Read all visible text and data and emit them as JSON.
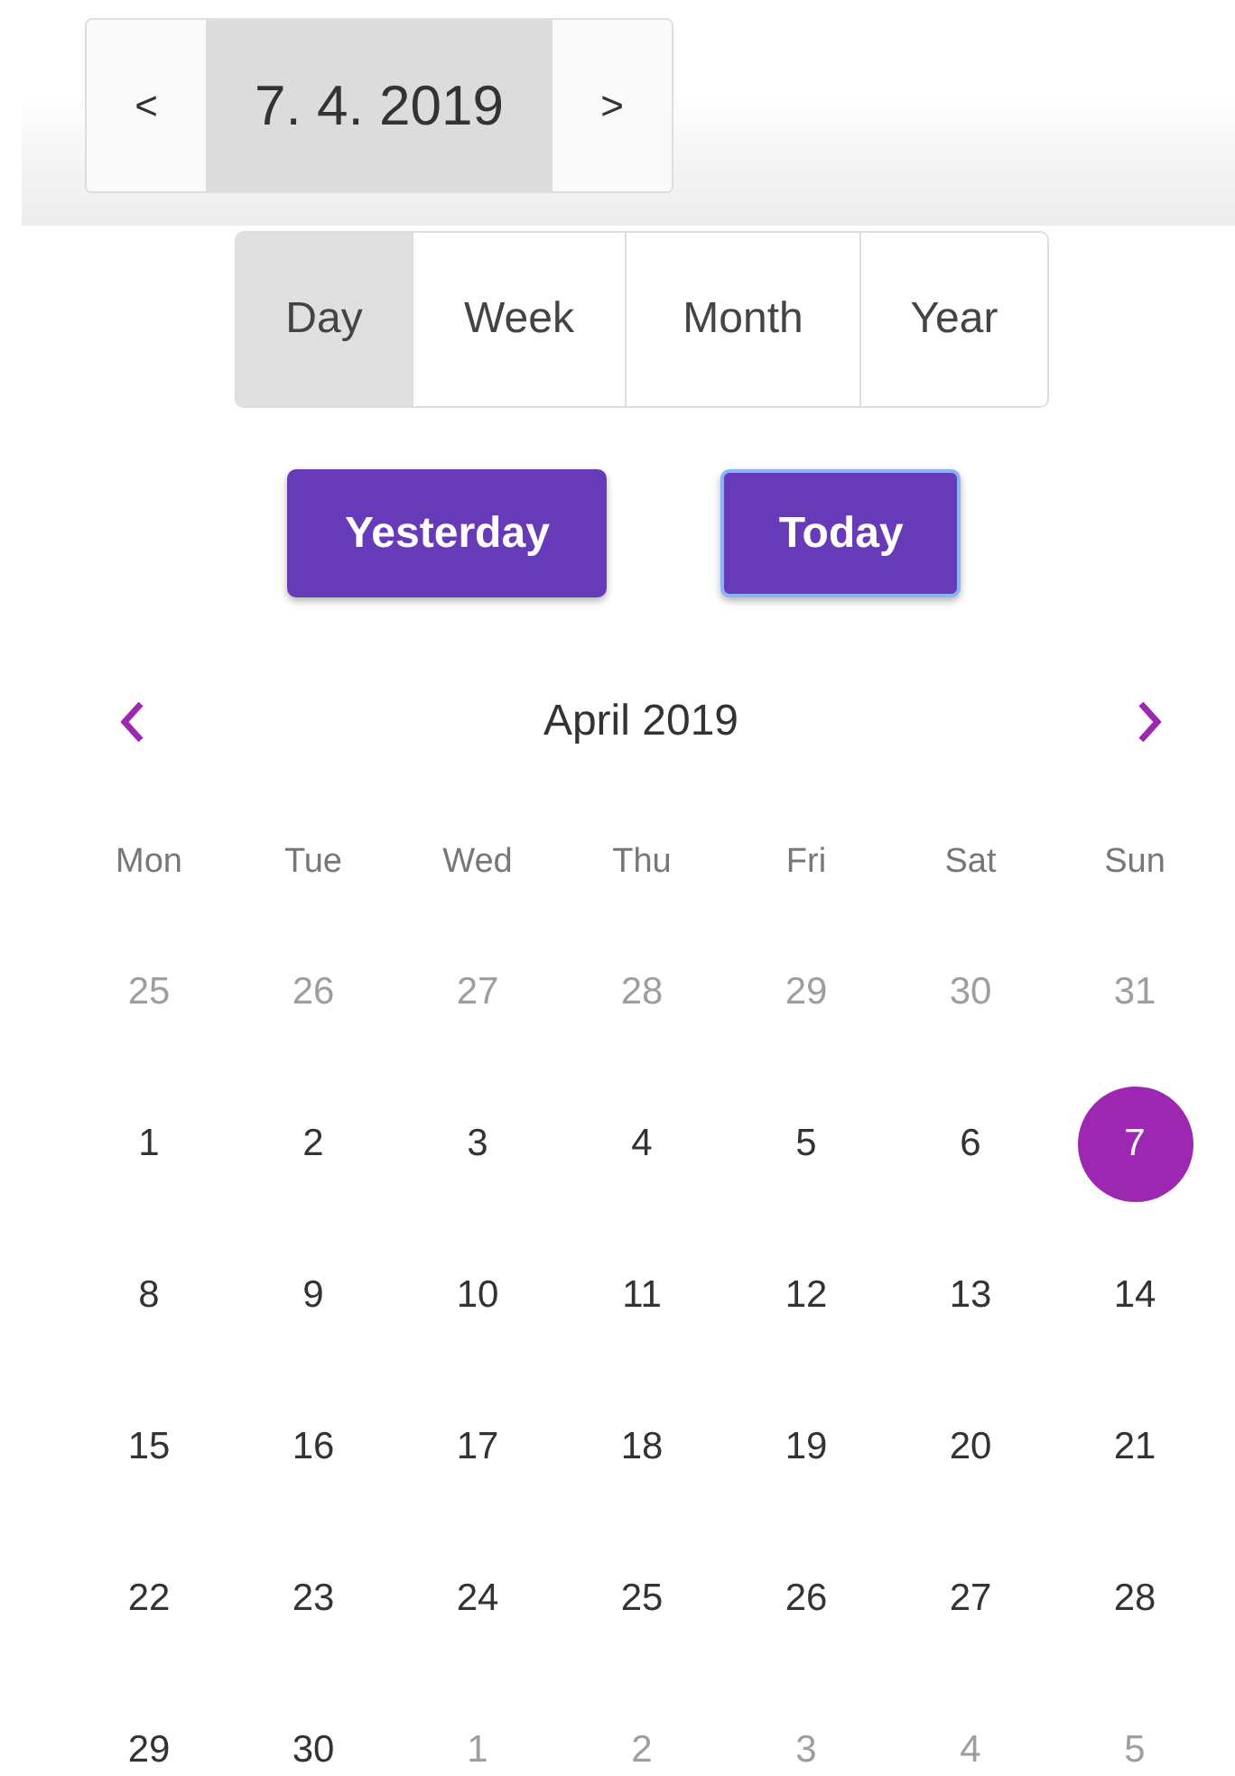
{
  "date_nav": {
    "prev": "<",
    "date": "7. 4. 2019",
    "next": ">"
  },
  "view_tabs": [
    {
      "label": "Day",
      "selected": true
    },
    {
      "label": "Week",
      "selected": false
    },
    {
      "label": "Month",
      "selected": false
    },
    {
      "label": "Year",
      "selected": false
    }
  ],
  "quick_buttons": [
    {
      "label": "Yesterday",
      "focused": false
    },
    {
      "label": "Today",
      "focused": true
    }
  ],
  "calendar": {
    "title": "April 2019",
    "weekdays": [
      "Mon",
      "Tue",
      "Wed",
      "Thu",
      "Fri",
      "Sat",
      "Sun"
    ],
    "weeks": [
      [
        {
          "label": "25",
          "outside": true,
          "selected": false
        },
        {
          "label": "26",
          "outside": true,
          "selected": false
        },
        {
          "label": "27",
          "outside": true,
          "selected": false
        },
        {
          "label": "28",
          "outside": true,
          "selected": false
        },
        {
          "label": "29",
          "outside": true,
          "selected": false
        },
        {
          "label": "30",
          "outside": true,
          "selected": false
        },
        {
          "label": "31",
          "outside": true,
          "selected": false
        }
      ],
      [
        {
          "label": "1",
          "outside": false,
          "selected": false
        },
        {
          "label": "2",
          "outside": false,
          "selected": false
        },
        {
          "label": "3",
          "outside": false,
          "selected": false
        },
        {
          "label": "4",
          "outside": false,
          "selected": false
        },
        {
          "label": "5",
          "outside": false,
          "selected": false
        },
        {
          "label": "6",
          "outside": false,
          "selected": false
        },
        {
          "label": "7",
          "outside": false,
          "selected": true
        }
      ],
      [
        {
          "label": "8",
          "outside": false,
          "selected": false
        },
        {
          "label": "9",
          "outside": false,
          "selected": false
        },
        {
          "label": "10",
          "outside": false,
          "selected": false
        },
        {
          "label": "11",
          "outside": false,
          "selected": false
        },
        {
          "label": "12",
          "outside": false,
          "selected": false
        },
        {
          "label": "13",
          "outside": false,
          "selected": false
        },
        {
          "label": "14",
          "outside": false,
          "selected": false
        }
      ],
      [
        {
          "label": "15",
          "outside": false,
          "selected": false
        },
        {
          "label": "16",
          "outside": false,
          "selected": false
        },
        {
          "label": "17",
          "outside": false,
          "selected": false
        },
        {
          "label": "18",
          "outside": false,
          "selected": false
        },
        {
          "label": "19",
          "outside": false,
          "selected": false
        },
        {
          "label": "20",
          "outside": false,
          "selected": false
        },
        {
          "label": "21",
          "outside": false,
          "selected": false
        }
      ],
      [
        {
          "label": "22",
          "outside": false,
          "selected": false
        },
        {
          "label": "23",
          "outside": false,
          "selected": false
        },
        {
          "label": "24",
          "outside": false,
          "selected": false
        },
        {
          "label": "25",
          "outside": false,
          "selected": false
        },
        {
          "label": "26",
          "outside": false,
          "selected": false
        },
        {
          "label": "27",
          "outside": false,
          "selected": false
        },
        {
          "label": "28",
          "outside": false,
          "selected": false
        }
      ],
      [
        {
          "label": "29",
          "outside": false,
          "selected": false
        },
        {
          "label": "30",
          "outside": false,
          "selected": false
        },
        {
          "label": "1",
          "outside": true,
          "selected": false
        },
        {
          "label": "2",
          "outside": true,
          "selected": false
        },
        {
          "label": "3",
          "outside": true,
          "selected": false
        },
        {
          "label": "4",
          "outside": true,
          "selected": false
        },
        {
          "label": "5",
          "outside": true,
          "selected": false
        }
      ]
    ]
  }
}
